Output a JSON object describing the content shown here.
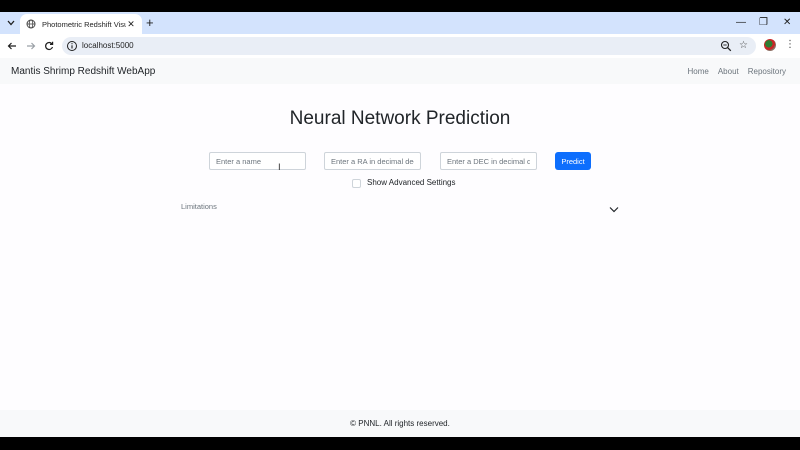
{
  "browser": {
    "tab_title": "Photometric Redshift Visualization",
    "tab_close": "✕",
    "new_tab": "+",
    "url": "localhost:5000",
    "win_min": "—",
    "win_restore": "❐",
    "win_close": "✕"
  },
  "app": {
    "brand": "Mantis Shrimp Redshift WebApp",
    "nav": [
      "Home",
      "About",
      "Repository"
    ]
  },
  "main": {
    "heading": "Neural Network Prediction",
    "name_placeholder": "Enter a name",
    "ra_placeholder": "Enter a RA in decimal degrees",
    "dec_placeholder": "Enter a DEC in decimal degrees",
    "predict_label": "Predict",
    "advanced_label": "Show Advanced Settings",
    "limitations_label": "Limitations"
  },
  "footer": {
    "text": "© PNNL. All rights reserved."
  },
  "colors": {
    "primary": "#0d6efd",
    "navbar_bg": "#f8f9fa",
    "tabbar_bg": "#d3e3fd"
  }
}
